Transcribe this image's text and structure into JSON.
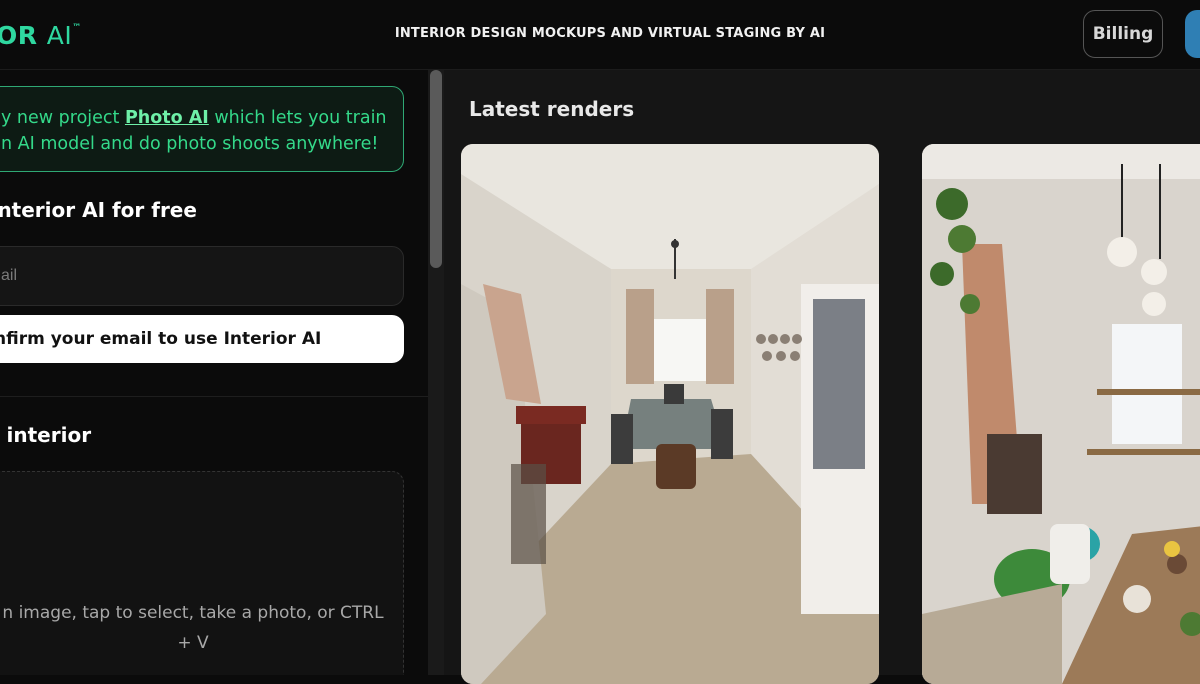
{
  "header": {
    "logo_main": "OR ",
    "logo_ai": "AI",
    "logo_tm": "™",
    "tagline": "INTERIOR DESIGN MOCKUPS AND VIRTUAL STAGING BY AI",
    "billing_label": "Billing"
  },
  "promo": {
    "line1_prefix": "y new project ",
    "link_text": "Photo AI",
    "line1_suffix": " which lets you train",
    "line2": "n AI model and do photo shoots anywhere!"
  },
  "signup": {
    "title": "Interior AI for free",
    "email_placeholder": "ail",
    "confirm_label": "nfirm your email to use Interior AI"
  },
  "upload": {
    "section_title": "t interior",
    "dropzone_text": "n image, tap to select, take a photo, or CTRL + V"
  },
  "renders": {
    "title": "Latest renders"
  },
  "colors": {
    "accent_green": "#2fd8a0",
    "background": "#0b0b0b",
    "panel": "#151515",
    "blue_button": "#2f7fb4"
  }
}
